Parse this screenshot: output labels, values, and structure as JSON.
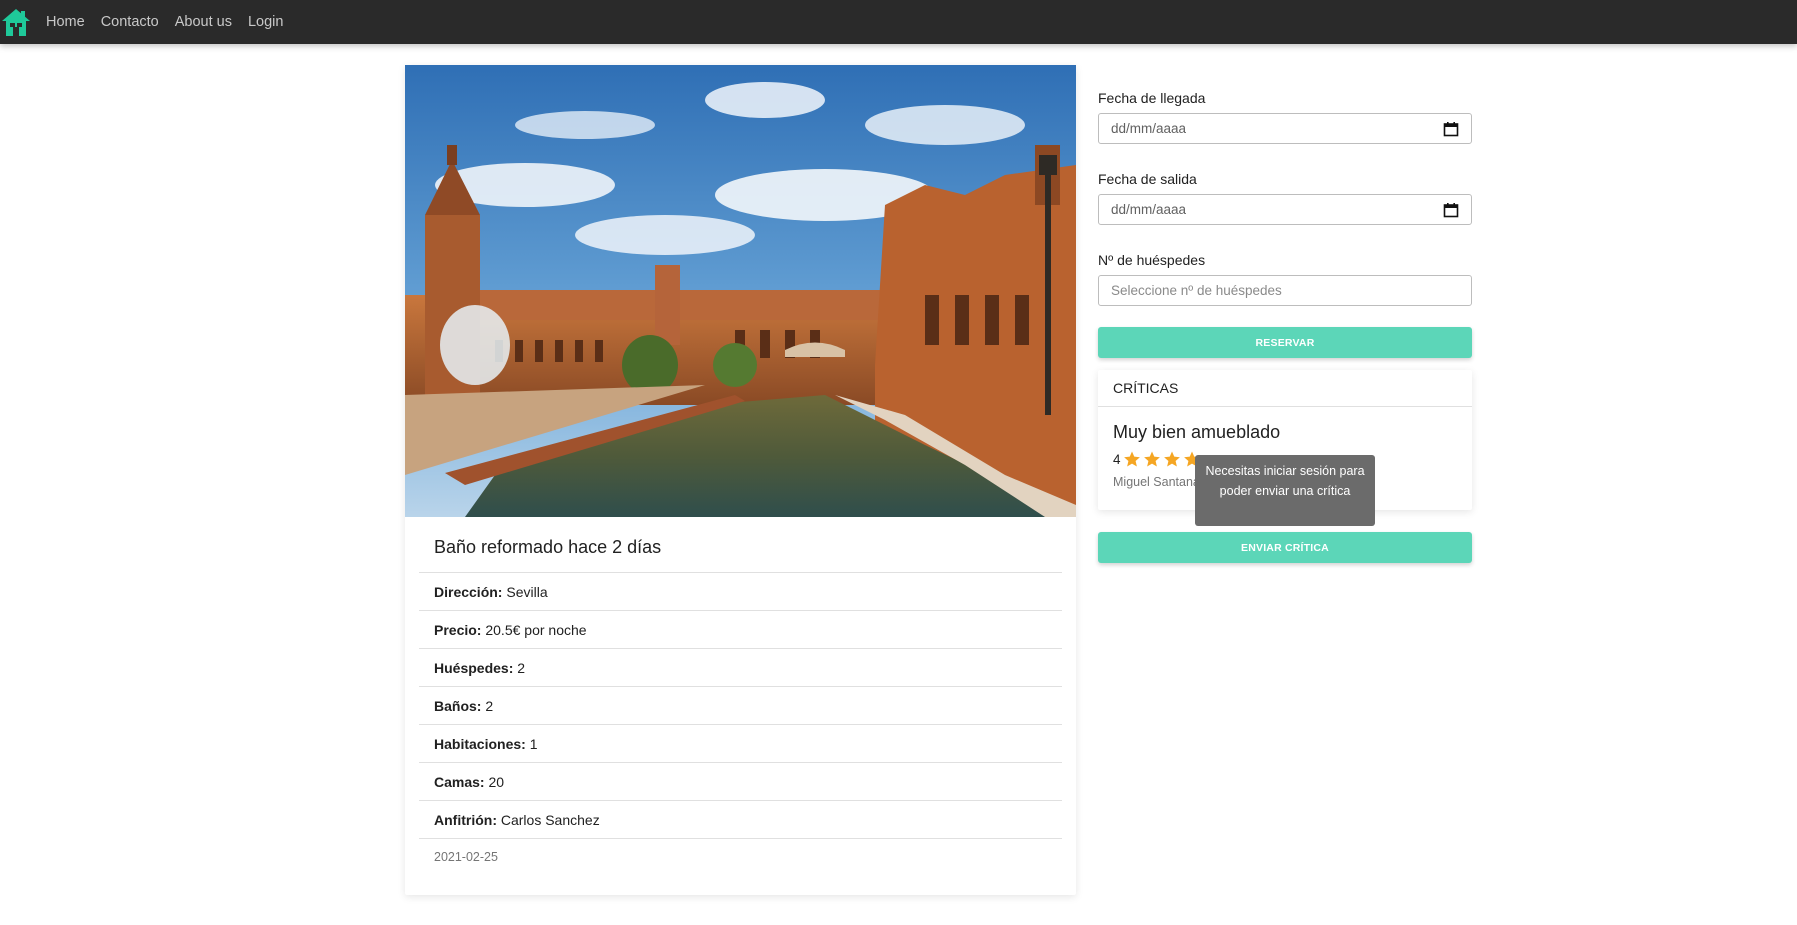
{
  "nav": {
    "links": [
      "Home",
      "Contacto",
      "About us",
      "Login"
    ]
  },
  "property": {
    "title": "Baño reformado hace 2 días",
    "details": [
      {
        "label": "Dirección:",
        "value": "Sevilla"
      },
      {
        "label": "Precio:",
        "value": "20.5€ por noche"
      },
      {
        "label": "Huéspedes:",
        "value": "2"
      },
      {
        "label": "Baños:",
        "value": "2"
      },
      {
        "label": "Habitaciones:",
        "value": "1"
      },
      {
        "label": "Camas:",
        "value": "20"
      },
      {
        "label": "Anfitrión:",
        "value": "Carlos Sanchez"
      }
    ],
    "date": "2021-02-25"
  },
  "booking": {
    "arrival_label": "Fecha de llegada",
    "arrival_placeholder": "dd/mm/aaaa",
    "departure_label": "Fecha de salida",
    "departure_placeholder": "dd/mm/aaaa",
    "guests_label": "Nº de huéspedes",
    "guests_placeholder": "Seleccione nº de huéspedes",
    "reserve_button": "RESERVAR"
  },
  "reviews": {
    "header": "CRÍTICAS",
    "items": [
      {
        "title": "Muy bien amueblado",
        "rating": 4,
        "author": "Miguel Santana"
      }
    ],
    "send_button": "ENVIAR CRÍTICA",
    "tooltip": "Necesitas iniciar sesión para poder enviar una crítica"
  },
  "colors": {
    "navbar": "#2a2a2a",
    "logo": "#1fc99a",
    "accent_button": "#5cd6b8",
    "star": "#f5a623",
    "tooltip_bg": "#6b6b6b"
  },
  "icons": [
    "home-icon",
    "calendar-icon",
    "star-icon"
  ]
}
